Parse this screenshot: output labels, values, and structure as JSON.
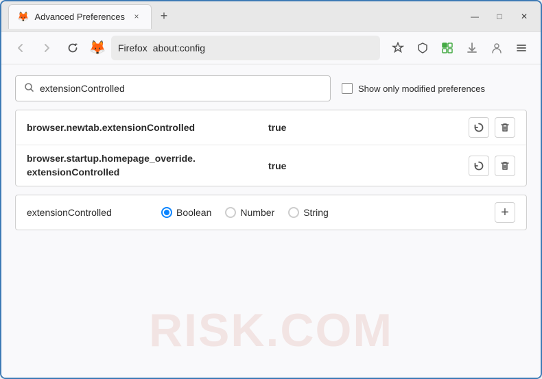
{
  "window": {
    "title": "Advanced Preferences",
    "tab_close": "×",
    "new_tab": "+",
    "minimize": "—",
    "maximize": "□",
    "close": "✕"
  },
  "nav": {
    "back": "←",
    "forward": "→",
    "refresh": "↻",
    "firefox_label": "🦊",
    "browser_name": "Firefox",
    "address": "about:config",
    "bookmark_icon": "☆",
    "shield_icon": "🛡",
    "extensions_icon": "🧩",
    "downloads_icon": "📥",
    "account_icon": "👤",
    "menu_icon": "☰"
  },
  "page": {
    "search_placeholder": "extensionControlled",
    "search_value": "extensionControlled",
    "checkbox_label": "Show only modified preferences",
    "watermark": "RISK.COM"
  },
  "results": [
    {
      "name": "browser.newtab.extensionControlled",
      "value": "true"
    },
    {
      "name": "browser.startup.homepage_override.\nextensionControlled",
      "name_line1": "browser.startup.homepage_override.",
      "name_line2": "extensionControlled",
      "multiline": true,
      "value": "true"
    }
  ],
  "new_pref": {
    "name": "extensionControlled",
    "types": [
      {
        "id": "boolean",
        "label": "Boolean",
        "selected": true
      },
      {
        "id": "number",
        "label": "Number",
        "selected": false
      },
      {
        "id": "string",
        "label": "String",
        "selected": false
      }
    ],
    "add_label": "+"
  },
  "icons": {
    "search": "🔍",
    "reset": "⇄",
    "delete": "🗑",
    "add": "+"
  }
}
